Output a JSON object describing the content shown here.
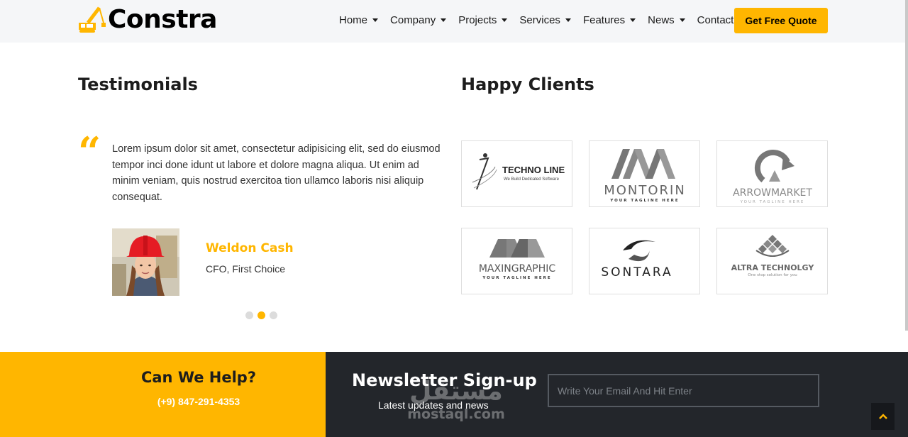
{
  "brand": {
    "name": "Constra",
    "accent": "#ffb600",
    "dark": "#23262b"
  },
  "nav": {
    "items": [
      {
        "label": "Home",
        "dropdown": true
      },
      {
        "label": "Company",
        "dropdown": true
      },
      {
        "label": "Projects",
        "dropdown": true
      },
      {
        "label": "Services",
        "dropdown": true
      },
      {
        "label": "Features",
        "dropdown": true
      },
      {
        "label": "News",
        "dropdown": true
      },
      {
        "label": "Contact",
        "dropdown": false
      }
    ],
    "cta_label": "Get Free Quote"
  },
  "testimonials": {
    "title": "Testimonials",
    "quote_icon": "quote-left-icon",
    "text": "Lorem ipsum dolor sit amet, consectetur adipisicing elit, sed do eiusmod tempor inci done idunt ut labore et dolore magna aliqua. Ut enim ad minim veniam, quis nostrud exercitoa tion ullamco laboris nisi aliquip consequat.",
    "author_name": "Weldon Cash",
    "author_role": "CFO, First Choice",
    "slides_total": 3,
    "active_slide": 2
  },
  "clients": {
    "title": "Happy Clients",
    "logos": [
      {
        "name": "TECHNO LINE",
        "tagline": "We Build Dedicated Software"
      },
      {
        "name": "MONTORIN",
        "tagline": "YOUR TAGLINE HERE"
      },
      {
        "name": "ARROWMARKET",
        "tagline": "YOUR TAGLINE HERE"
      },
      {
        "name": "MAXINGRAPHIC",
        "tagline": "YOUR TAGLINE HERE"
      },
      {
        "name": "SONTARA",
        "tagline": ""
      },
      {
        "name": "ALTRA TECHNOLGY",
        "tagline": "One stop solution for you"
      }
    ]
  },
  "help": {
    "title": "Can We Help?",
    "phone": "(+9) 847-291-4353"
  },
  "newsletter": {
    "title": "Newsletter Sign-up",
    "subtitle": "Latest updates and news",
    "placeholder": "Write Your Email And Hit Enter"
  },
  "back_to_top_icon": "chevron-up-icon",
  "watermark": {
    "arabic": "مستقل",
    "latin": "mostaql.com"
  }
}
